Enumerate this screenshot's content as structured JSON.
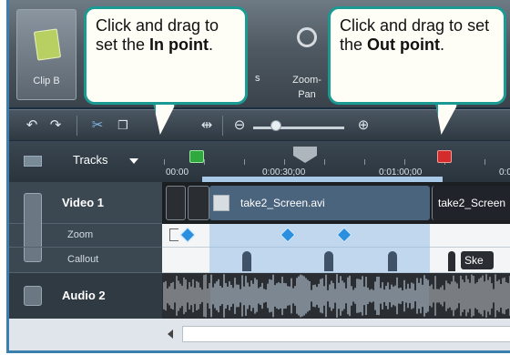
{
  "ribbon": {
    "clip_bin_label": "Clip B",
    "partial_label": "s",
    "zoom_pan_label_line1": "Zoom-",
    "zoom_pan_label_line2": "Pan"
  },
  "toolbar": {
    "undo_icon": "undo-icon",
    "redo_icon": "redo-icon",
    "cut_icon": "scissors-icon",
    "copy_icon": "copy-icon",
    "split_icon": "split-icon",
    "zoom_out_icon": "zoom-out-icon",
    "zoom_in_icon": "zoom-in-icon",
    "zoom_level": 0.25
  },
  "tracks_menu": {
    "label": "Tracks"
  },
  "ruler": {
    "times": [
      "00:00",
      "0:00:30;00",
      "0:01:00;00",
      "0:0"
    ]
  },
  "tracks": {
    "video": {
      "name": "Video 1"
    },
    "zoom": {
      "name": "Zoom"
    },
    "callout": {
      "name": "Callout"
    },
    "audio": {
      "name": "Audio 2"
    }
  },
  "clips": {
    "main": "take2_Screen.avi",
    "right": "take2_Screen",
    "callout_tag": "Ske"
  },
  "bubbles": {
    "in": {
      "pre": "Click and drag to set the ",
      "bold": "In point",
      "post": "."
    },
    "out": {
      "pre": "Click and drag to set the ",
      "bold": "Out point",
      "post": "."
    }
  },
  "colors": {
    "in_marker": "#2fa83e",
    "out_marker": "#d42b2b",
    "bubble_border": "#1a9a93",
    "selection": "#a8c9e8"
  }
}
